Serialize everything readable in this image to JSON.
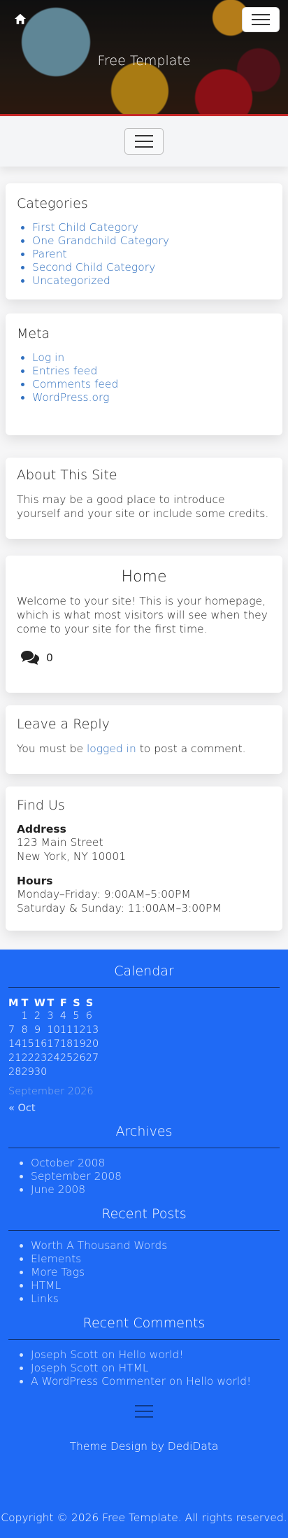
{
  "hero": {
    "title": "Free Template",
    "home_icon": "home-icon",
    "menu_icon": "hamburger-icon"
  },
  "nav": {
    "toggle_icon": "hamburger-icon"
  },
  "categories": {
    "title": "Categories",
    "items": [
      "First Child Category",
      "One Grandchild Category",
      "Parent",
      "Second Child Category",
      "Uncategorized"
    ]
  },
  "meta": {
    "title": "Meta",
    "items": [
      "Log in",
      "Entries feed",
      "Comments feed",
      "WordPress.org"
    ]
  },
  "about": {
    "title": "About This Site",
    "text": "This may be a good place to introduce yourself and your site or include some credits."
  },
  "home": {
    "title": "Home",
    "text": "Welcome to your site! This is your homepage, which is what most visitors will see when they come to your site for the first time.",
    "comment_icon": "comments-icon",
    "comment_count": "0"
  },
  "reply": {
    "title": "Leave a Reply",
    "before": "You must be ",
    "link": "logged in",
    "after": " to post a comment."
  },
  "findus": {
    "title": "Find Us",
    "address_label": "Address",
    "address_line1": "123 Main Street",
    "address_line2": "New York, NY 10001",
    "hours_label": "Hours",
    "hours_line1": "Monday–Friday: 9:00AM–5:00PM",
    "hours_line2": "Saturday & Sunday: 11:00AM–3:00PM"
  },
  "footer": {
    "calendar": {
      "title": "Calendar",
      "days": [
        "M",
        "T",
        "W",
        "T",
        "F",
        "S",
        "S"
      ],
      "weeks": [
        [
          "",
          "1",
          "2",
          "3",
          "4",
          "5",
          "6"
        ],
        [
          "7",
          "8",
          "9",
          "10",
          "11",
          "12",
          "13"
        ],
        [
          "14",
          "15",
          "16",
          "17",
          "18",
          "19",
          "20"
        ],
        [
          "21",
          "22",
          "23",
          "24",
          "25",
          "26",
          "27"
        ],
        [
          "28",
          "29",
          "30",
          "",
          "",
          "",
          ""
        ]
      ],
      "caption": "September 2026",
      "prev": "« Oct"
    },
    "archives": {
      "title": "Archives",
      "items": [
        "October 2008",
        "September 2008",
        "June 2008"
      ]
    },
    "recent_posts": {
      "title": "Recent Posts",
      "items": [
        "Worth A Thousand Words",
        "Elements",
        "More Tags",
        "HTML",
        "Links"
      ]
    },
    "recent_comments": {
      "title": "Recent Comments",
      "items": [
        {
          "author": "Joseph Scott",
          "on": " on ",
          "post": "Hello world!"
        },
        {
          "author": "Joseph Scott",
          "on": " on ",
          "post": "HTML"
        },
        {
          "author": "A WordPress Commenter",
          "on": " on ",
          "post": "Hello world!"
        }
      ]
    },
    "toggle_icon": "hamburger-icon",
    "credit_prefix": "Theme Design by ",
    "credit_link": "DediData",
    "copyright": "Copyright © 2026 Free Template. All rights reserved."
  },
  "colors": {
    "accent": "#2f6fbf",
    "footer_bg": "#1f6af5",
    "hero_border": "#c62828"
  }
}
